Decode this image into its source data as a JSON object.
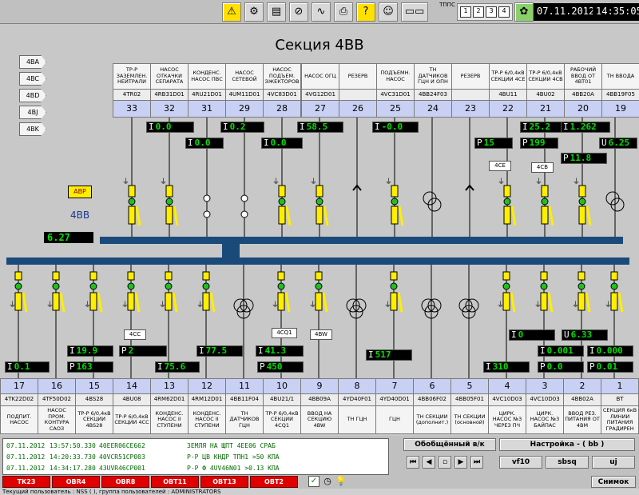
{
  "topbar": {
    "icons": [
      "warning-icon",
      "gears-icon",
      "document-icon",
      "no-entry-icon",
      "sine-wave-icon",
      "printer-icon",
      "help-icon",
      "user-icon",
      "computer-icon"
    ],
    "ttps_label": "ТППС",
    "panel_numbers": [
      "1",
      "2",
      "3",
      "4"
    ],
    "date": "07.11.2012",
    "time": "14:35:05"
  },
  "page_title": "Секция 4ВВ",
  "side_buttons": [
    "4BA",
    "4BC",
    "4BD",
    "4BJ",
    "4BK"
  ],
  "avr_label": "АВР",
  "section_label": "4ВВ",
  "section_value": "6.27",
  "top_cells": [
    {
      "name": "ТР-Р ЗАЗЕМЛЕН. НЕЙТРАЛИ",
      "id": "4TR02",
      "num": "33"
    },
    {
      "name": "НАСОС ОТКАЧКИ СЕПАРАТА",
      "id": "4RB31D01",
      "num": "32"
    },
    {
      "name": "КОНДЕНС. НАСОС ПВС",
      "id": "4RU21D01",
      "num": "31"
    },
    {
      "name": "НАСОС СЕТЕВОЙ",
      "id": "4UM11D01",
      "num": "29"
    },
    {
      "name": "НАСОС ПОДЪЕМ. ЭЖЕКТОРОВ",
      "id": "4VC83D01",
      "num": "28"
    },
    {
      "name": "НАСОС ОГЦ",
      "id": "4VG12D01",
      "num": "27"
    },
    {
      "name": "РЕЗЕРВ",
      "id": "",
      "num": "26"
    },
    {
      "name": "ПОДЪЕМН. НАСОС",
      "id": "4VC31D01",
      "num": "25"
    },
    {
      "name": "ТН ДАТЧИКОВ ГЦН И ОПН",
      "id": "4BB24F03",
      "num": "24"
    },
    {
      "name": "РЕЗЕРВ",
      "id": "",
      "num": "23"
    },
    {
      "name": "ТР-Р 6/0,4кВ СЕКЦИИ 4CE",
      "id": "4BU11",
      "num": "22"
    },
    {
      "name": "ТР-Р 6/0,4кВ СЕКЦИИ 4CB",
      "id": "4BU02",
      "num": "21"
    },
    {
      "name": "РАБОЧИЙ ВВОД ОТ 4BT01",
      "id": "4BB20A",
      "num": "20"
    },
    {
      "name": "ТН ВВОДА",
      "id": "4BB19F05",
      "num": "19"
    }
  ],
  "bottom_cells": [
    {
      "num": "17",
      "id": "4TK22D02",
      "name": "ПОДПИТ. НАСОС"
    },
    {
      "num": "16",
      "id": "4TF50D02",
      "name": "НАСОС ПРОМ. КОНТУРА САОЗ"
    },
    {
      "num": "15",
      "id": "4BS28",
      "name": "ТР-Р 6/0,4кВ СЕКЦИИ 4BS28"
    },
    {
      "num": "14",
      "id": "4BU08",
      "name": "ТР-Р 6/0,4кВ СЕКЦИИ 4CC"
    },
    {
      "num": "13",
      "id": "4RM62D01",
      "name": "КОНДЕНС. НАСОС II СТУПЕНИ"
    },
    {
      "num": "12",
      "id": "4RM12D01",
      "name": "КОНДЕНС. НАСОС II СТУПЕНИ"
    },
    {
      "num": "11",
      "id": "4BB11F04",
      "name": "ТН ДАТЧИКОВ ГЦН"
    },
    {
      "num": "10",
      "id": "4BU21/1",
      "name": "ТР-Р 6/0,4кВ СЕКЦИИ 4CQ1"
    },
    {
      "num": "9",
      "id": "4BB09A",
      "name": "ВВОД НА СЕКЦИЮ 4BW"
    },
    {
      "num": "8",
      "id": "4YD40F01",
      "name": "ТН ГЦН"
    },
    {
      "num": "7",
      "id": "4YD40D01",
      "name": "ГЦН"
    },
    {
      "num": "6",
      "id": "4BB06F02",
      "name": "ТН СЕКЦИИ (дополнит.)"
    },
    {
      "num": "5",
      "id": "4BB05F01",
      "name": "ТН СЕКЦИИ (основной)"
    },
    {
      "num": "4",
      "id": "4VC10D03",
      "name": "ЦИРК. НАСОС №3 ЧЕРЕЗ ПЧ"
    },
    {
      "num": "3",
      "id": "4VC10D03",
      "name": "ЦИРК. НАСОС №3 БАЙПАС"
    },
    {
      "num": "2",
      "id": "4BB02A",
      "name": "ВВОД РЕЗ. ПИТАНИЯ ОТ 4BM"
    },
    {
      "num": "1",
      "id": "BT",
      "name": "СЕКЦИЯ 6кВ ЛИНИИ ПИТАНИЯ ГРАДИРЕН"
    }
  ],
  "top_readouts": [
    {
      "lbl": "I",
      "val": "0.0"
    },
    {
      "lbl": "I",
      "val": "0.0"
    },
    {
      "lbl": "I",
      "val": "0.2"
    },
    {
      "lbl": "I",
      "val": "0.0"
    },
    {
      "lbl": "I",
      "val": "58.5"
    },
    {
      "lbl": "I",
      "val": "-0.0"
    },
    {
      "lbl": "P",
      "val": "15"
    },
    {
      "lbl": "I",
      "val": "25.2"
    },
    {
      "lbl": "P",
      "val": "199"
    },
    {
      "lbl": "I",
      "val": "1.262"
    },
    {
      "lbl": "U",
      "val": "6.25"
    },
    {
      "lbl": "P",
      "val": "11.8"
    }
  ],
  "bottom_readouts": [
    {
      "lbl": "I",
      "val": "0.1"
    },
    {
      "lbl": "I",
      "val": "19.9"
    },
    {
      "lbl": "P",
      "val": "163"
    },
    {
      "lbl": "P",
      "val": "2"
    },
    {
      "lbl": "I",
      "val": "75.6"
    },
    {
      "lbl": "I",
      "val": "77.5"
    },
    {
      "lbl": "I",
      "val": "41.3"
    },
    {
      "lbl": "P",
      "val": "450"
    },
    {
      "lbl": "I",
      "val": "517"
    },
    {
      "lbl": "I",
      "val": "0"
    },
    {
      "lbl": "U",
      "val": "6.33"
    },
    {
      "lbl": "I",
      "val": "0.001"
    },
    {
      "lbl": "I",
      "val": "0.000"
    },
    {
      "lbl": "I",
      "val": "310"
    },
    {
      "lbl": "P",
      "val": "0.0"
    },
    {
      "lbl": "P",
      "val": "0.01"
    }
  ],
  "tags": [
    "4CE",
    "4CB",
    "4CC",
    "4CQ1",
    "4BW"
  ],
  "alarms": [
    {
      "date": "07.11.2012",
      "time": "13:57:50.330",
      "code": "40EER06CE662",
      "text": "ЗЕМЛЯ НА ЩПТ 4EE06 СРАБ"
    },
    {
      "date": "07.11.2012",
      "time": "14:20:33.730",
      "code": "40VCR51CP003",
      "text": "Р-Р ЦВ КНДР ТПН1 >50 КПА"
    },
    {
      "date": "07.11.2012",
      "time": "14:34:17.280",
      "code": "43UVR46CP001",
      "text": "Р-Р Ф 4UV46N01 >0.13 КПА"
    }
  ],
  "controls": {
    "generalized": "Обобщённый в/к",
    "settings": "Настройка - ( bb )",
    "btn1": "vf10",
    "btn2": "sbsq",
    "btn3": "uj",
    "snapshot": "Снимок"
  },
  "red_buttons": [
    "TK23",
    "OBR4",
    "OBR8",
    "OBT11",
    "OBT13",
    "OBT2"
  ],
  "status_line": "Текущий пользователь : NSS ( ), группа пользователей : ADMINISTRATORS",
  "colors": {
    "busbar": "#1a4a7a",
    "readout_green": "#00e000",
    "alarm_green": "#006a00",
    "red_button": "#e00000",
    "yellow": "#ffee00"
  }
}
